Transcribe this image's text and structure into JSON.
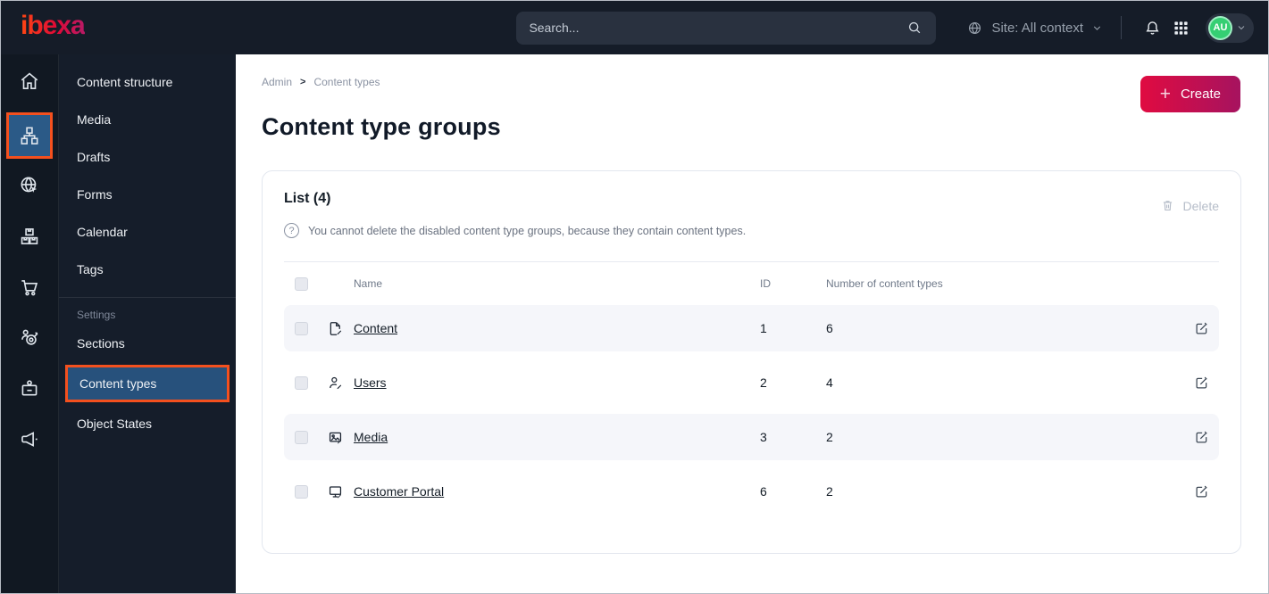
{
  "topbar": {
    "logo": "ibexa",
    "search_placeholder": "Search...",
    "site_selector": "Site: All context",
    "avatar_initials": "AU",
    "icons": [
      "search-icon",
      "globe-icon",
      "chevron-down-icon",
      "bell-icon",
      "app-grid-icon"
    ]
  },
  "sidebar": {
    "icons": [
      "home-icon",
      "content-tree-icon",
      "site-globe-icon",
      "product-boxes-icon",
      "cart-icon",
      "customer-target-icon",
      "admin-badge-icon",
      "megaphone-icon"
    ],
    "active_icon": "content-tree-icon",
    "annotation_color": "#f4501e",
    "active_bg_color": "#2b5a87"
  },
  "menu": {
    "items": [
      "Content structure",
      "Media",
      "Drafts",
      "Forms",
      "Calendar",
      "Tags"
    ],
    "settings_label": "Settings",
    "settings_items": [
      "Sections",
      "Content types",
      "Object States"
    ],
    "active_item": "Content types"
  },
  "main": {
    "breadcrumb": {
      "items": [
        "Admin",
        "Content types"
      ],
      "separator": ">"
    },
    "create_label": "Create",
    "title": "Content type groups",
    "list": {
      "title": "List (4)",
      "delete_label": "Delete",
      "info": "You cannot delete the disabled content type groups, because they contain content types.",
      "columns": {
        "name": "Name",
        "id": "ID",
        "count": "Number of content types"
      },
      "rows": [
        {
          "icon": "file-icon",
          "name": "Content",
          "id": "1",
          "count": "6"
        },
        {
          "icon": "user-icon",
          "name": "Users",
          "id": "2",
          "count": "4"
        },
        {
          "icon": "image-icon",
          "name": "Media",
          "id": "3",
          "count": "2"
        },
        {
          "icon": "monitor-icon",
          "name": "Customer Portal",
          "id": "6",
          "count": "2"
        }
      ]
    }
  },
  "colors": {
    "topbar_bg": "#151c28",
    "rail_bg": "#111822",
    "panel_bg": "#151d2a",
    "annotation_orange": "#f4501e",
    "active_blue": "#27517c",
    "create_gradient_start": "#e00b41",
    "create_gradient_end": "#a6135f",
    "avatar_green": "#35cf73",
    "row_shade": "#f5f6fa"
  }
}
